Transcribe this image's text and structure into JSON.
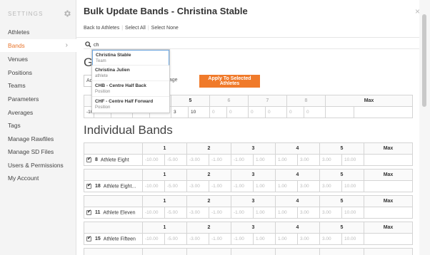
{
  "sidebar": {
    "title": "SETTINGS",
    "items": [
      {
        "label": "Athletes"
      },
      {
        "label": "Bands",
        "active": true
      },
      {
        "label": "Venues"
      },
      {
        "label": "Positions"
      },
      {
        "label": "Teams"
      },
      {
        "label": "Parameters"
      },
      {
        "label": "Averages"
      },
      {
        "label": "Tags"
      },
      {
        "label": "Manage Rawfiles"
      },
      {
        "label": "Manage SD Files"
      },
      {
        "label": "Users & Permissions"
      },
      {
        "label": "My Account"
      }
    ]
  },
  "page": {
    "title": "Bulk Update Bands - Christina Stable",
    "close": "×"
  },
  "toolbar": {
    "back": "Back to Athletes",
    "select_all": "Select All",
    "select_none": "Select None"
  },
  "search": {
    "value": "ch",
    "results": [
      {
        "name": "Christina Stable",
        "sub": "Team"
      },
      {
        "name": "Christina Julien",
        "sub": "athlete"
      },
      {
        "name": "CHB - Centre Half Back",
        "sub": "Position"
      },
      {
        "name": "CHF - Centre Half Forward",
        "sub": "Position"
      }
    ]
  },
  "global": {
    "heading_visible": "G",
    "select_value": "Acc",
    "pct_label": "ntage",
    "apply": "Apply To Selected Athletes",
    "headers": [
      "3",
      "4",
      "5",
      "6",
      "7",
      "8",
      "Max"
    ],
    "first_input": "-10",
    "values": [
      "1",
      "1",
      "3",
      "10",
      "0",
      "0",
      "0",
      "0",
      "0",
      "0"
    ]
  },
  "individual": {
    "heading": "Individual Bands",
    "headers": [
      "1",
      "2",
      "3",
      "4",
      "5",
      "Max"
    ],
    "values": [
      "-10.00",
      "-5.00",
      "-3.00",
      "-1.00",
      "-1.00",
      "1.00",
      "1.00",
      "3.00",
      "3.00",
      "10.00"
    ],
    "athletes": [
      {
        "num": "8",
        "name": "Athlete Eight"
      },
      {
        "num": "18",
        "name": "Athlete Eight..."
      },
      {
        "num": "11",
        "name": "Athlete Eleven"
      },
      {
        "num": "15",
        "name": "Athlete Fifteen"
      },
      {
        "num": "",
        "name": ""
      }
    ]
  }
}
